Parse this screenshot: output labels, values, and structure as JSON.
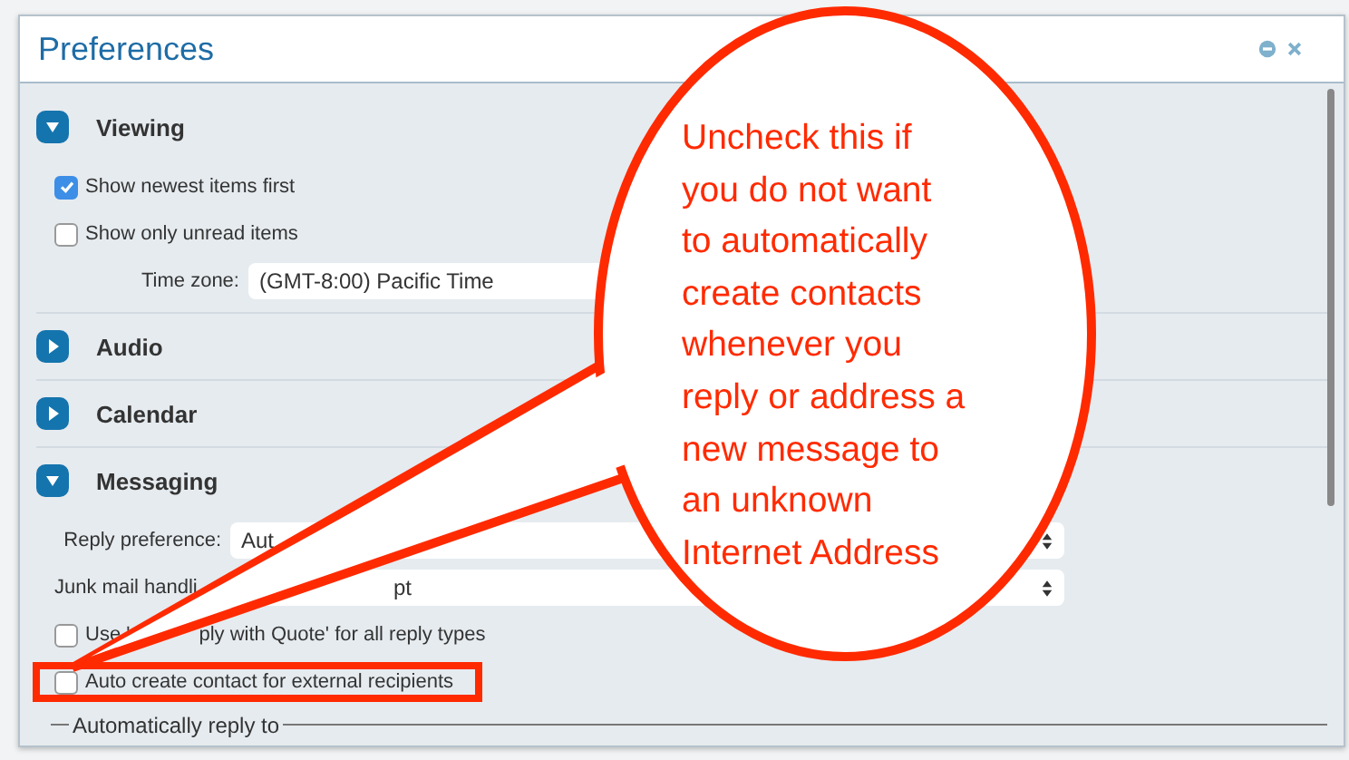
{
  "window": {
    "title": "Preferences"
  },
  "sections": [
    {
      "title": "Viewing",
      "expanded": true,
      "items": [
        {
          "kind": "checkbox",
          "label": "Show newest items first",
          "checked": true
        },
        {
          "kind": "checkbox",
          "label": "Show only unread items",
          "checked": false
        },
        {
          "kind": "select",
          "label": "Time zone:",
          "value": "(GMT-8:00) Pacific Time"
        }
      ]
    },
    {
      "title": "Audio",
      "expanded": false
    },
    {
      "title": "Calendar",
      "expanded": false
    },
    {
      "title": "Messaging",
      "expanded": true,
      "items": [
        {
          "kind": "select",
          "label": "Reply preference:",
          "value": "Aut",
          "wide": true
        },
        {
          "kind": "select",
          "label": "Junk mail handli",
          "value": "pt",
          "wide": true,
          "value_obscured": true
        },
        {
          "kind": "checkbox",
          "label": "Use '",
          "label_rest": "ply with Quote' for all reply types",
          "checked": false
        },
        {
          "kind": "checkbox",
          "label": "Auto create contact for external recipients",
          "checked": false,
          "highlighted": true
        },
        {
          "kind": "group",
          "label": "Automatically reply to"
        }
      ]
    }
  ],
  "callout": {
    "lines": [
      "Uncheck this if",
      "you do not want",
      "to automatically",
      "create contacts",
      "whenever you",
      "reply or address a",
      "new message to",
      "an unknown",
      "Internet Address"
    ]
  }
}
